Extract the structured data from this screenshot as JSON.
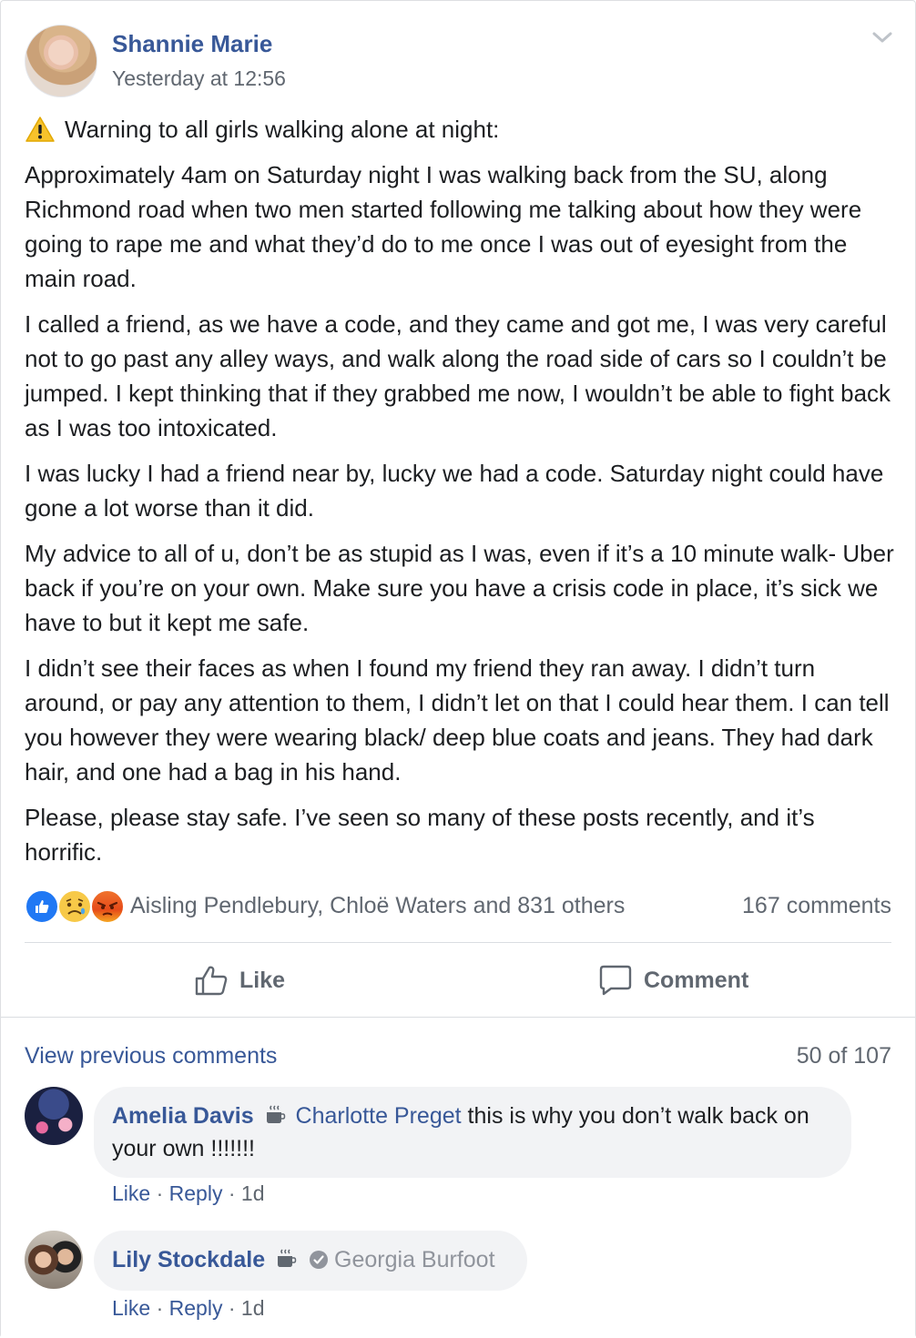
{
  "post": {
    "author": "Shannie Marie",
    "timestamp": "Yesterday at 12:56",
    "paragraphs": [
      "Warning to all girls walking alone at night:",
      "Approximately 4am on Saturday night I was walking back from the SU, along Richmond road when two men started following me talking about how they were going to rape me and what they’d do to me once I was out of eyesight from the main road.",
      "I called a friend, as we have a code, and they came and got me, I was very careful not to go past any alley ways, and walk along the road side of cars so I couldn’t be jumped. I kept thinking that if they grabbed me now, I wouldn’t be able to fight back as I was too intoxicated.",
      "I was lucky I had a friend near by, lucky we had a code. Saturday night could have gone a lot worse than it did.",
      "My advice to all of u, don’t be as stupid as I was, even if it’s a 10 minute walk- Uber back if you’re on your own. Make sure you have a crisis code in place, it’s sick we have to but it kept me safe.",
      "I didn’t see their faces as when I found my friend they ran away. I didn’t turn around, or pay any attention to them, I didn’t let on that I could hear them. I can tell you however they were wearing black/ deep blue coats and jeans. They had dark hair, and one had a bag in his hand.",
      "Please, please stay safe. I’ve seen so many of these posts recently, and it’s horrific."
    ],
    "warning_icon": "warning-icon"
  },
  "reactions": {
    "icons": [
      "like-reaction-icon",
      "sad-reaction-icon",
      "angry-reaction-icon"
    ],
    "names": "Aisling Pendlebury, Chloë Waters and 831 others",
    "comments_count": "167 comments"
  },
  "actions": {
    "like_label": "Like",
    "comment_label": "Comment"
  },
  "comments": {
    "view_previous": "View previous comments",
    "paging": "50 of 107",
    "items": [
      {
        "author": "Amelia Davis",
        "tag": "Charlotte Preget",
        "text": " this is why you don’t walk back on your own !!!!!!!",
        "like": "Like",
        "reply": "Reply",
        "age": "1d"
      },
      {
        "author": "Lily Stockdale",
        "tag": "Georgia Burfoot",
        "text": "",
        "like": "Like",
        "reply": "Reply",
        "age": "1d"
      }
    ]
  },
  "colors": {
    "link_blue": "#385898",
    "meta_grey": "#606770",
    "bubble_bg": "#f2f3f5",
    "like_blue": "#2078f4"
  }
}
